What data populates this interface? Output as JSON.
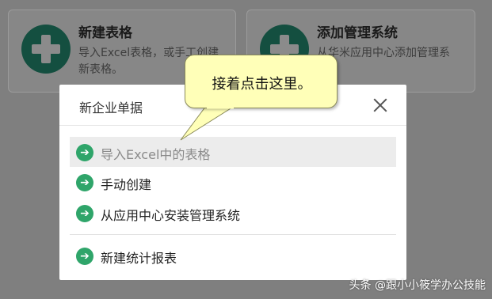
{
  "background_cards": [
    {
      "title": "新建表格",
      "description": "导入Excel表格，或手工创建新表格。",
      "icon": "plus-circle-icon"
    },
    {
      "title": "添加管理系统",
      "description": "从华米应用中心添加管理系统。",
      "icon": "plus-circle-icon"
    }
  ],
  "dialog": {
    "title": "新企业单据",
    "close_icon": "close-icon",
    "items": [
      {
        "label": "导入Excel中的表格",
        "icon": "arrow-right-circle-icon",
        "highlighted": true
      },
      {
        "label": "手动创建",
        "icon": "arrow-right-circle-icon"
      },
      {
        "label": "从应用中心安装管理系统",
        "icon": "arrow-right-circle-icon"
      },
      {
        "label": "新建统计报表",
        "icon": "arrow-right-circle-icon"
      }
    ]
  },
  "callout": {
    "text": "接着点击这里。"
  },
  "watermark": {
    "text": "头条 @跟小小筱学办公技能"
  },
  "colors": {
    "overlay": "#7f7f7f",
    "accent_green": "#2fa56a",
    "callout_fill": "#ffffb8",
    "highlight_row": "#ececec"
  }
}
